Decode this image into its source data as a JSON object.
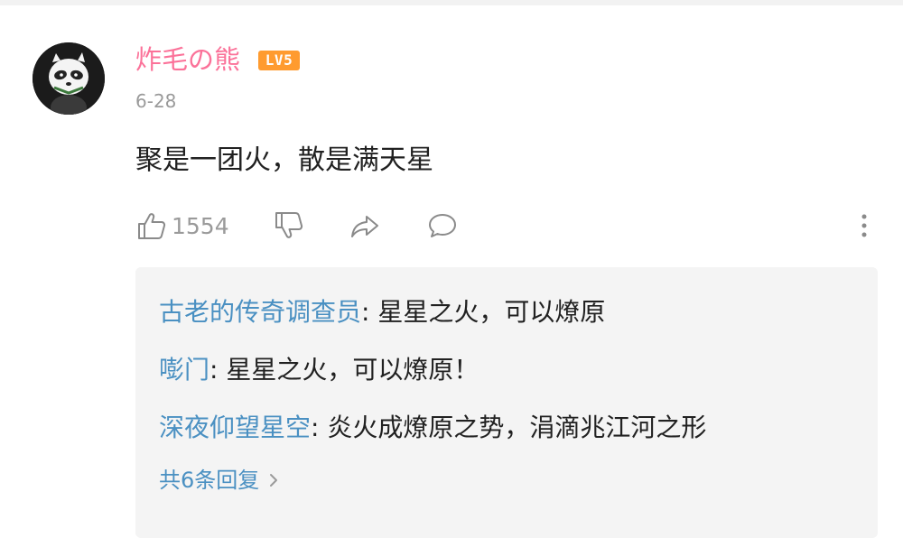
{
  "comment": {
    "username": "炸毛の熊",
    "level": "LV5",
    "date": "6-28",
    "text": "聚是一团火，散是满天星",
    "like_count": "1554",
    "icons": {
      "avatar": "panda-avatar",
      "like": "thumbs-up-icon",
      "dislike": "thumbs-down-icon",
      "share": "share-arrow-icon",
      "comment": "speech-bubble-icon",
      "more": "more-vertical-icon"
    }
  },
  "replies": {
    "items": [
      {
        "author": "古老的传奇调查员",
        "text": "星星之火，可以燎原"
      },
      {
        "author": "嘭门",
        "text": "星星之火，可以燎原！"
      },
      {
        "author": "深夜仰望星空",
        "text": "炎火成燎原之势，涓滴兆江河之形"
      }
    ],
    "view_all": "共6条回复"
  },
  "colors": {
    "username": "#fb7299",
    "level_badge": "#ff9b2f",
    "link": "#4a90c2",
    "muted": "#9a9a9a",
    "text": "#212121",
    "reply_bg": "#f4f4f4"
  }
}
